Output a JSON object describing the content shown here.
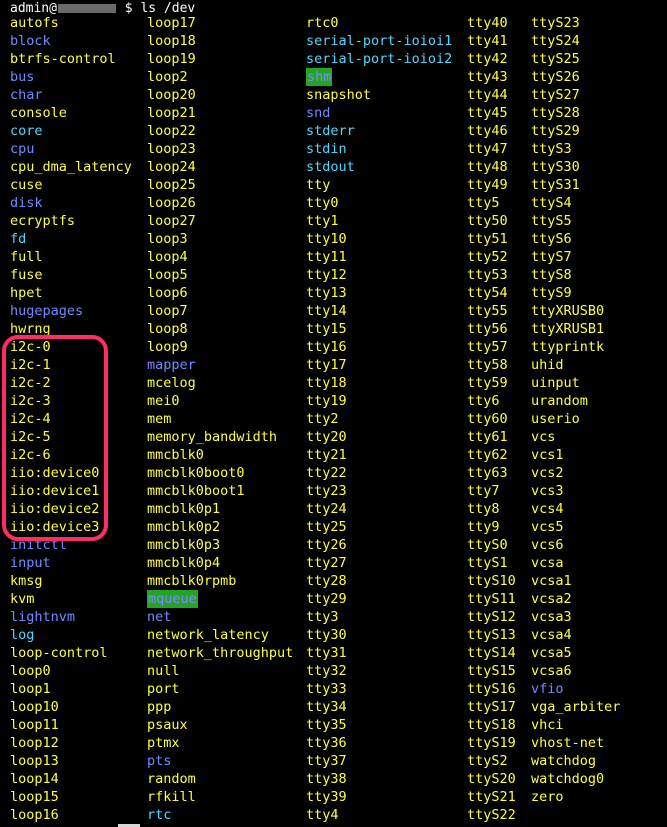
{
  "terminal": {
    "prompt_user": "admin@",
    "prompt_suffix": " $ ",
    "command": "ls /dev",
    "highlight_color": "#ff2d63",
    "colors": {
      "file": "#ffff3c",
      "dir": "#6f8cff",
      "link": "#4fd8ff",
      "background": "#000000",
      "highlight_bg": "#22a522"
    }
  },
  "columns": [
    {
      "items": [
        {
          "name": "autofs",
          "type": "file"
        },
        {
          "name": "block",
          "type": "dir"
        },
        {
          "name": "btrfs-control",
          "type": "file"
        },
        {
          "name": "bus",
          "type": "dir"
        },
        {
          "name": "char",
          "type": "dir"
        },
        {
          "name": "console",
          "type": "file"
        },
        {
          "name": "core",
          "type": "link"
        },
        {
          "name": "cpu",
          "type": "dir"
        },
        {
          "name": "cpu_dma_latency",
          "type": "file"
        },
        {
          "name": "cuse",
          "type": "file"
        },
        {
          "name": "disk",
          "type": "dir"
        },
        {
          "name": "ecryptfs",
          "type": "file"
        },
        {
          "name": "fd",
          "type": "link"
        },
        {
          "name": "full",
          "type": "file"
        },
        {
          "name": "fuse",
          "type": "file"
        },
        {
          "name": "hpet",
          "type": "file"
        },
        {
          "name": "hugepages",
          "type": "dir"
        },
        {
          "name": "hwrng",
          "type": "file"
        },
        {
          "name": "i2c-0",
          "type": "file"
        },
        {
          "name": "i2c-1",
          "type": "file"
        },
        {
          "name": "i2c-2",
          "type": "file"
        },
        {
          "name": "i2c-3",
          "type": "file"
        },
        {
          "name": "i2c-4",
          "type": "file"
        },
        {
          "name": "i2c-5",
          "type": "file"
        },
        {
          "name": "i2c-6",
          "type": "file"
        },
        {
          "name": "iio:device0",
          "type": "file"
        },
        {
          "name": "iio:device1",
          "type": "file"
        },
        {
          "name": "iio:device2",
          "type": "file"
        },
        {
          "name": "iio:device3",
          "type": "file"
        },
        {
          "name": "initctl",
          "type": "dir"
        },
        {
          "name": "input",
          "type": "dir"
        },
        {
          "name": "kmsg",
          "type": "file"
        },
        {
          "name": "kvm",
          "type": "file"
        },
        {
          "name": "lightnvm",
          "type": "dir"
        },
        {
          "name": "log",
          "type": "link"
        },
        {
          "name": "loop-control",
          "type": "file"
        },
        {
          "name": "loop0",
          "type": "file"
        },
        {
          "name": "loop1",
          "type": "file"
        },
        {
          "name": "loop10",
          "type": "file"
        },
        {
          "name": "loop11",
          "type": "file"
        },
        {
          "name": "loop12",
          "type": "file"
        },
        {
          "name": "loop13",
          "type": "file"
        },
        {
          "name": "loop14",
          "type": "file"
        },
        {
          "name": "loop15",
          "type": "file"
        },
        {
          "name": "loop16",
          "type": "file"
        }
      ]
    },
    {
      "items": [
        {
          "name": "loop17",
          "type": "file"
        },
        {
          "name": "loop18",
          "type": "file"
        },
        {
          "name": "loop19",
          "type": "file"
        },
        {
          "name": "loop2",
          "type": "file"
        },
        {
          "name": "loop20",
          "type": "file"
        },
        {
          "name": "loop21",
          "type": "file"
        },
        {
          "name": "loop22",
          "type": "file"
        },
        {
          "name": "loop23",
          "type": "file"
        },
        {
          "name": "loop24",
          "type": "file"
        },
        {
          "name": "loop25",
          "type": "file"
        },
        {
          "name": "loop26",
          "type": "file"
        },
        {
          "name": "loop27",
          "type": "file"
        },
        {
          "name": "loop3",
          "type": "file"
        },
        {
          "name": "loop4",
          "type": "file"
        },
        {
          "name": "loop5",
          "type": "file"
        },
        {
          "name": "loop6",
          "type": "file"
        },
        {
          "name": "loop7",
          "type": "file"
        },
        {
          "name": "loop8",
          "type": "file"
        },
        {
          "name": "loop9",
          "type": "file"
        },
        {
          "name": "mapper",
          "type": "dir"
        },
        {
          "name": "mcelog",
          "type": "file"
        },
        {
          "name": "mei0",
          "type": "file"
        },
        {
          "name": "mem",
          "type": "file"
        },
        {
          "name": "memory_bandwidth",
          "type": "file"
        },
        {
          "name": "mmcblk0",
          "type": "file"
        },
        {
          "name": "mmcblk0boot0",
          "type": "file"
        },
        {
          "name": "mmcblk0boot1",
          "type": "file"
        },
        {
          "name": "mmcblk0p1",
          "type": "file"
        },
        {
          "name": "mmcblk0p2",
          "type": "file"
        },
        {
          "name": "mmcblk0p3",
          "type": "file"
        },
        {
          "name": "mmcblk0p4",
          "type": "file"
        },
        {
          "name": "mmcblk0rpmb",
          "type": "file"
        },
        {
          "name": "mqueue",
          "type": "hl"
        },
        {
          "name": "net",
          "type": "dir"
        },
        {
          "name": "network_latency",
          "type": "file"
        },
        {
          "name": "network_throughput",
          "type": "file"
        },
        {
          "name": "null",
          "type": "file"
        },
        {
          "name": "port",
          "type": "file"
        },
        {
          "name": "ppp",
          "type": "file"
        },
        {
          "name": "psaux",
          "type": "file"
        },
        {
          "name": "ptmx",
          "type": "file"
        },
        {
          "name": "pts",
          "type": "dir"
        },
        {
          "name": "random",
          "type": "file"
        },
        {
          "name": "rfkill",
          "type": "file"
        },
        {
          "name": "rtc",
          "type": "link"
        }
      ]
    },
    {
      "items": [
        {
          "name": "rtc0",
          "type": "file"
        },
        {
          "name": "serial-port-ioioi1",
          "type": "link"
        },
        {
          "name": "serial-port-ioioi2",
          "type": "link"
        },
        {
          "name": "shm",
          "type": "hl"
        },
        {
          "name": "snapshot",
          "type": "file"
        },
        {
          "name": "snd",
          "type": "dir"
        },
        {
          "name": "stderr",
          "type": "link"
        },
        {
          "name": "stdin",
          "type": "link"
        },
        {
          "name": "stdout",
          "type": "link"
        },
        {
          "name": "tty",
          "type": "file"
        },
        {
          "name": "tty0",
          "type": "file"
        },
        {
          "name": "tty1",
          "type": "file"
        },
        {
          "name": "tty10",
          "type": "file"
        },
        {
          "name": "tty11",
          "type": "file"
        },
        {
          "name": "tty12",
          "type": "file"
        },
        {
          "name": "tty13",
          "type": "file"
        },
        {
          "name": "tty14",
          "type": "file"
        },
        {
          "name": "tty15",
          "type": "file"
        },
        {
          "name": "tty16",
          "type": "file"
        },
        {
          "name": "tty17",
          "type": "file"
        },
        {
          "name": "tty18",
          "type": "file"
        },
        {
          "name": "tty19",
          "type": "file"
        },
        {
          "name": "tty2",
          "type": "file"
        },
        {
          "name": "tty20",
          "type": "file"
        },
        {
          "name": "tty21",
          "type": "file"
        },
        {
          "name": "tty22",
          "type": "file"
        },
        {
          "name": "tty23",
          "type": "file"
        },
        {
          "name": "tty24",
          "type": "file"
        },
        {
          "name": "tty25",
          "type": "file"
        },
        {
          "name": "tty26",
          "type": "file"
        },
        {
          "name": "tty27",
          "type": "file"
        },
        {
          "name": "tty28",
          "type": "file"
        },
        {
          "name": "tty29",
          "type": "file"
        },
        {
          "name": "tty3",
          "type": "file"
        },
        {
          "name": "tty30",
          "type": "file"
        },
        {
          "name": "tty31",
          "type": "file"
        },
        {
          "name": "tty32",
          "type": "file"
        },
        {
          "name": "tty33",
          "type": "file"
        },
        {
          "name": "tty34",
          "type": "file"
        },
        {
          "name": "tty35",
          "type": "file"
        },
        {
          "name": "tty36",
          "type": "file"
        },
        {
          "name": "tty37",
          "type": "file"
        },
        {
          "name": "tty38",
          "type": "file"
        },
        {
          "name": "tty39",
          "type": "file"
        },
        {
          "name": "tty4",
          "type": "file"
        }
      ]
    },
    {
      "items": [
        {
          "name": "tty40",
          "type": "file"
        },
        {
          "name": "tty41",
          "type": "file"
        },
        {
          "name": "tty42",
          "type": "file"
        },
        {
          "name": "tty43",
          "type": "file"
        },
        {
          "name": "tty44",
          "type": "file"
        },
        {
          "name": "tty45",
          "type": "file"
        },
        {
          "name": "tty46",
          "type": "file"
        },
        {
          "name": "tty47",
          "type": "file"
        },
        {
          "name": "tty48",
          "type": "file"
        },
        {
          "name": "tty49",
          "type": "file"
        },
        {
          "name": "tty5",
          "type": "file"
        },
        {
          "name": "tty50",
          "type": "file"
        },
        {
          "name": "tty51",
          "type": "file"
        },
        {
          "name": "tty52",
          "type": "file"
        },
        {
          "name": "tty53",
          "type": "file"
        },
        {
          "name": "tty54",
          "type": "file"
        },
        {
          "name": "tty55",
          "type": "file"
        },
        {
          "name": "tty56",
          "type": "file"
        },
        {
          "name": "tty57",
          "type": "file"
        },
        {
          "name": "tty58",
          "type": "file"
        },
        {
          "name": "tty59",
          "type": "file"
        },
        {
          "name": "tty6",
          "type": "file"
        },
        {
          "name": "tty60",
          "type": "file"
        },
        {
          "name": "tty61",
          "type": "file"
        },
        {
          "name": "tty62",
          "type": "file"
        },
        {
          "name": "tty63",
          "type": "file"
        },
        {
          "name": "tty7",
          "type": "file"
        },
        {
          "name": "tty8",
          "type": "file"
        },
        {
          "name": "tty9",
          "type": "file"
        },
        {
          "name": "ttyS0",
          "type": "file"
        },
        {
          "name": "ttyS1",
          "type": "file"
        },
        {
          "name": "ttyS10",
          "type": "file"
        },
        {
          "name": "ttyS11",
          "type": "file"
        },
        {
          "name": "ttyS12",
          "type": "file"
        },
        {
          "name": "ttyS13",
          "type": "file"
        },
        {
          "name": "ttyS14",
          "type": "file"
        },
        {
          "name": "ttyS15",
          "type": "file"
        },
        {
          "name": "ttyS16",
          "type": "file"
        },
        {
          "name": "ttyS17",
          "type": "file"
        },
        {
          "name": "ttyS18",
          "type": "file"
        },
        {
          "name": "ttyS19",
          "type": "file"
        },
        {
          "name": "ttyS2",
          "type": "file"
        },
        {
          "name": "ttyS20",
          "type": "file"
        },
        {
          "name": "ttyS21",
          "type": "file"
        },
        {
          "name": "ttyS22",
          "type": "file"
        }
      ]
    },
    {
      "items": [
        {
          "name": "ttyS23",
          "type": "file"
        },
        {
          "name": "ttyS24",
          "type": "file"
        },
        {
          "name": "ttyS25",
          "type": "file"
        },
        {
          "name": "ttyS26",
          "type": "file"
        },
        {
          "name": "ttyS27",
          "type": "file"
        },
        {
          "name": "ttyS28",
          "type": "file"
        },
        {
          "name": "ttyS29",
          "type": "file"
        },
        {
          "name": "ttyS3",
          "type": "file"
        },
        {
          "name": "ttyS30",
          "type": "file"
        },
        {
          "name": "ttyS31",
          "type": "file"
        },
        {
          "name": "ttyS4",
          "type": "file"
        },
        {
          "name": "ttyS5",
          "type": "file"
        },
        {
          "name": "ttyS6",
          "type": "file"
        },
        {
          "name": "ttyS7",
          "type": "file"
        },
        {
          "name": "ttyS8",
          "type": "file"
        },
        {
          "name": "ttyS9",
          "type": "file"
        },
        {
          "name": "ttyXRUSB0",
          "type": "file"
        },
        {
          "name": "ttyXRUSB1",
          "type": "file"
        },
        {
          "name": "ttyprintk",
          "type": "file"
        },
        {
          "name": "uhid",
          "type": "file"
        },
        {
          "name": "uinput",
          "type": "file"
        },
        {
          "name": "urandom",
          "type": "file"
        },
        {
          "name": "userio",
          "type": "file"
        },
        {
          "name": "vcs",
          "type": "file"
        },
        {
          "name": "vcs1",
          "type": "file"
        },
        {
          "name": "vcs2",
          "type": "file"
        },
        {
          "name": "vcs3",
          "type": "file"
        },
        {
          "name": "vcs4",
          "type": "file"
        },
        {
          "name": "vcs5",
          "type": "file"
        },
        {
          "name": "vcs6",
          "type": "file"
        },
        {
          "name": "vcsa",
          "type": "file"
        },
        {
          "name": "vcsa1",
          "type": "file"
        },
        {
          "name": "vcsa2",
          "type": "file"
        },
        {
          "name": "vcsa3",
          "type": "file"
        },
        {
          "name": "vcsa4",
          "type": "file"
        },
        {
          "name": "vcsa5",
          "type": "file"
        },
        {
          "name": "vcsa6",
          "type": "file"
        },
        {
          "name": "vfio",
          "type": "dir"
        },
        {
          "name": "vga_arbiter",
          "type": "file"
        },
        {
          "name": "vhci",
          "type": "file"
        },
        {
          "name": "vhost-net",
          "type": "file"
        },
        {
          "name": "watchdog",
          "type": "file"
        },
        {
          "name": "watchdog0",
          "type": "file"
        },
        {
          "name": "zero",
          "type": "file"
        }
      ]
    }
  ]
}
